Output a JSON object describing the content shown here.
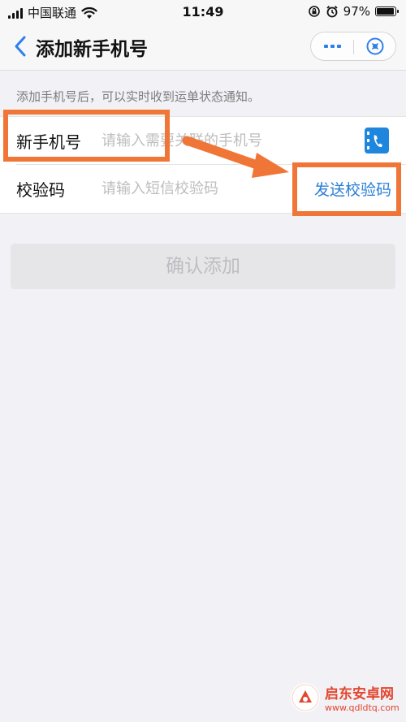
{
  "status_bar": {
    "carrier": "中国联通",
    "time": "11:49",
    "battery_percent": "97%",
    "battery_level": 0.97,
    "signal_bars": 4
  },
  "nav": {
    "title": "添加新手机号",
    "icons": {
      "back": "chevron-left-icon",
      "more": "more-dots-icon",
      "close": "close-circle-icon"
    }
  },
  "hint": "添加手机号后，可以实时收到运单状态通知。",
  "form": {
    "phone": {
      "label": "新手机号",
      "placeholder": "请输入需要关联的手机号",
      "value": "",
      "icon": "contact-book-icon"
    },
    "code": {
      "label": "校验码",
      "placeholder": "请输入短信校验码",
      "value": "",
      "action": "发送校验码"
    }
  },
  "confirm_button": "确认添加",
  "watermark": {
    "title": "启东安卓网",
    "url": "www.qdldtq.com"
  },
  "colors": {
    "accent_blue": "#2a7fd6",
    "highlight_orange": "#f07637",
    "background": "#f2f1f6",
    "disabled_button": "#e6e6e9",
    "watermark_red": "#e2462f"
  }
}
